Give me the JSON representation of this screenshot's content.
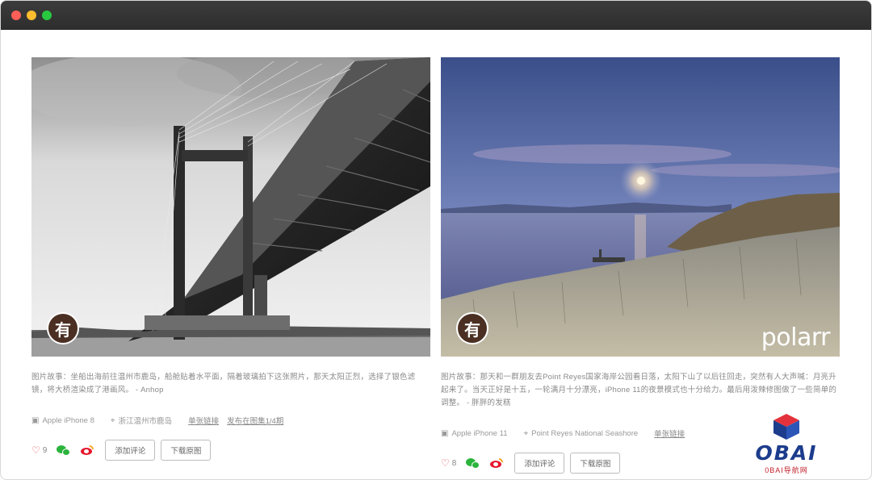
{
  "cards": [
    {
      "avatar_char": "有",
      "story": "图片故事：坐船出海前往温州市鹿岛，船舱贴着水平面，隔着玻璃拍下这张照片，那天太阳正烈，选择了银色滤镜，将大桥渲染成了港画风。 - Anhop",
      "device": "Apple iPhone 8",
      "location": "浙江温州市鹿岛",
      "link_single": "单张链接",
      "link_gallery": "发布在图集1/4期",
      "likes": "9",
      "comment_btn": "添加评论",
      "download_btn": "下载原图"
    },
    {
      "avatar_char": "有",
      "watermark": "polarr",
      "story": "图片故事：那天和一群朋友去Point Reyes国家海岸公园看日落，太阳下山了以后往回走，突然有人大声喊：月亮升起来了。当天正好是十五，一轮满月十分漂亮，iPhone 11的夜景模式也十分给力。最后用泼辣修图做了一些简单的调整。 - 胖胖的发糕",
      "device": "Apple iPhone 11",
      "location": "Point Reyes National Seashore",
      "link_single": "单张链接",
      "likes": "8",
      "comment_btn": "添加评论",
      "download_btn": "下载原图"
    }
  ],
  "logo": {
    "brand": "OBAI",
    "sub": "0BAI导航网",
    "colors": {
      "brand": "#1c3c8c",
      "accent": "#c0202a"
    }
  },
  "icons": [
    "camera-icon",
    "location-pin-icon",
    "heart-icon",
    "wechat-icon",
    "weibo-icon"
  ]
}
